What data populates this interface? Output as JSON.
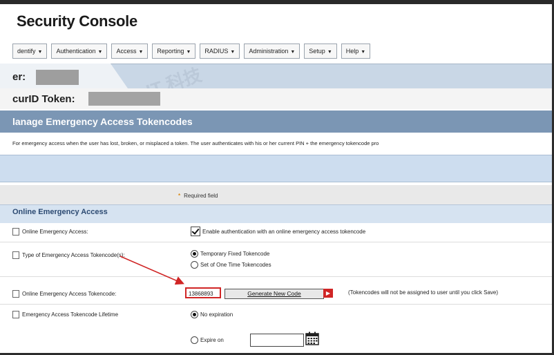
{
  "app": {
    "title": "Security Console"
  },
  "menu": [
    {
      "label": "dentify"
    },
    {
      "label": "Authentication"
    },
    {
      "label": "Access"
    },
    {
      "label": "Reporting"
    },
    {
      "label": "RADIUS"
    },
    {
      "label": "Administration"
    },
    {
      "label": "Setup"
    },
    {
      "label": "Help"
    }
  ],
  "user": {
    "label": "er:",
    "token_label": "curID Token:"
  },
  "section": {
    "title": "lanage Emergency Access Tokencodes",
    "description": "For emergency access when the user has lost, broken, or misplaced a token. The user authenticates with his or her current PIN + the emergency tokencode pro"
  },
  "form": {
    "required_note": "Required field",
    "subsection_title": "Online Emergency Access",
    "rows": {
      "online_access": {
        "label": "Online Emergency Access:",
        "option": "Enable authentication with an online emergency access tokencode"
      },
      "type": {
        "label": "Type of Emergency Access Tokencode(s):",
        "options": [
          "Temporary Fixed Tokencode",
          "Set of One Time Tokencodes"
        ]
      },
      "tokencode": {
        "label": "Online Emergency Access Tokencode:",
        "value": "13868893",
        "button": "Generate New Code",
        "note": "(Tokencodes will not be assigned to user until you click Save)"
      },
      "lifetime": {
        "label": "Emergency Access Tokencode Lifetime",
        "options": [
          "No expiration",
          "Expire on"
        ]
      }
    }
  },
  "colors": {
    "annotation_red": "#d02525",
    "header_blue": "#7b96b4"
  },
  "watermark": "IT 科技"
}
